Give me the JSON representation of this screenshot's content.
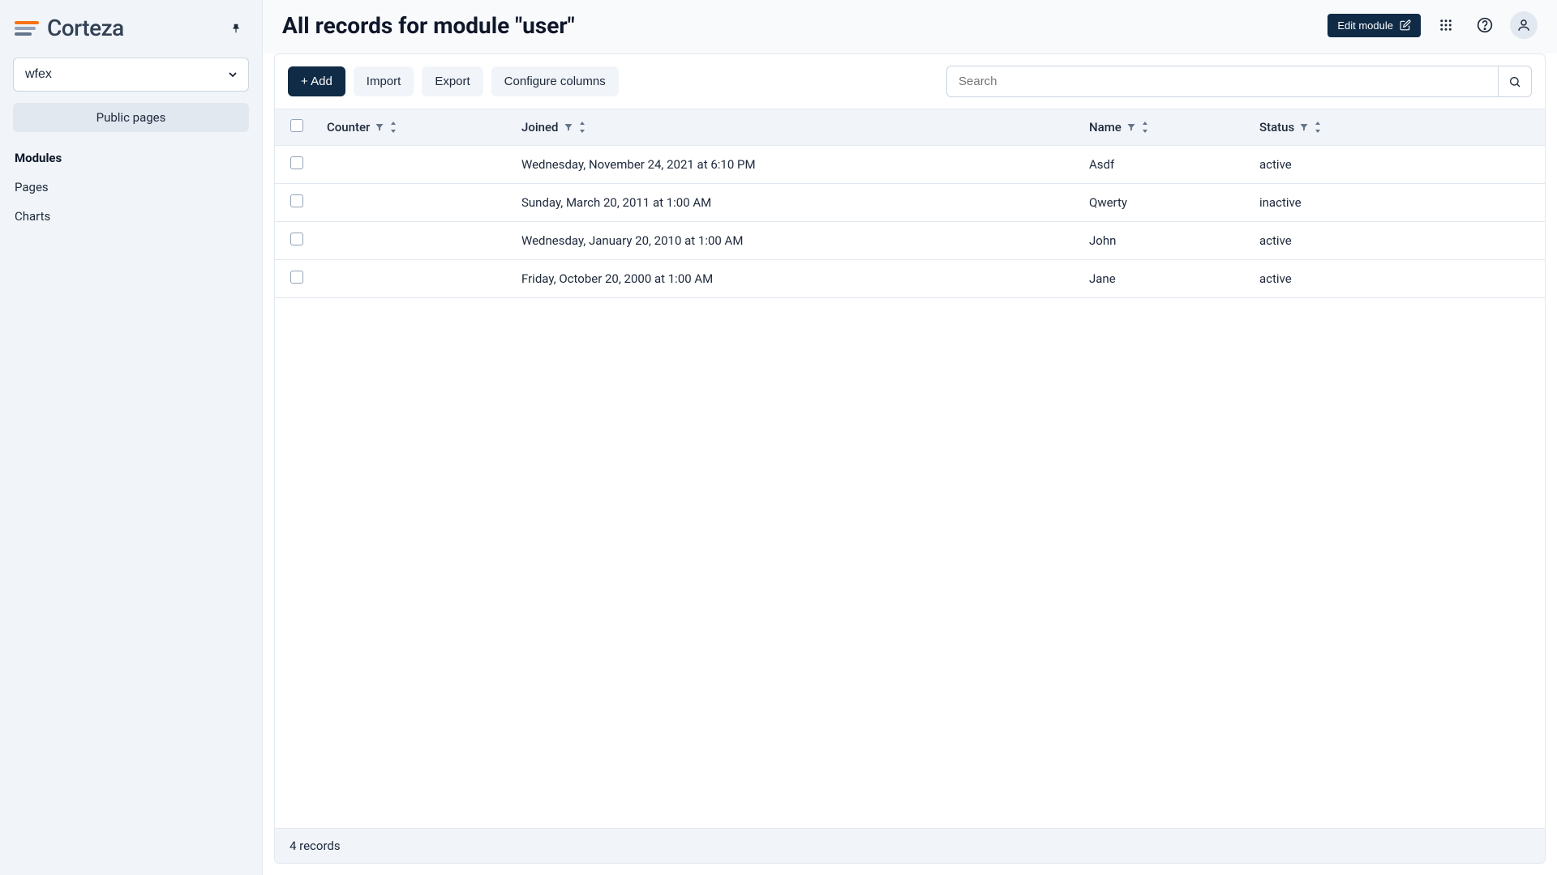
{
  "brand": {
    "name": "Corteza"
  },
  "sidebar": {
    "namespace": "wfex",
    "public_pages_label": "Public pages",
    "nav": [
      {
        "label": "Modules",
        "active": true
      },
      {
        "label": "Pages",
        "active": false
      },
      {
        "label": "Charts",
        "active": false
      }
    ]
  },
  "header": {
    "title": "All records for module \"user\"",
    "edit_module_label": "Edit module"
  },
  "toolbar": {
    "add_label": "+ Add",
    "import_label": "Import",
    "export_label": "Export",
    "configure_columns_label": "Configure columns",
    "search_placeholder": "Search"
  },
  "table": {
    "columns": [
      {
        "key": "counter",
        "label": "Counter"
      },
      {
        "key": "joined",
        "label": "Joined"
      },
      {
        "key": "name",
        "label": "Name"
      },
      {
        "key": "status",
        "label": "Status"
      }
    ],
    "rows": [
      {
        "counter": "",
        "joined": "Wednesday, November 24, 2021 at 6:10 PM",
        "name": "Asdf",
        "status": "active"
      },
      {
        "counter": "",
        "joined": "Sunday, March 20, 2011 at 1:00 AM",
        "name": "Qwerty",
        "status": "inactive"
      },
      {
        "counter": "",
        "joined": "Wednesday, January 20, 2010 at 1:00 AM",
        "name": "John",
        "status": "active"
      },
      {
        "counter": "",
        "joined": "Friday, October 20, 2000 at 1:00 AM",
        "name": "Jane",
        "status": "active"
      }
    ]
  },
  "footer": {
    "record_count_text": "4 records"
  }
}
